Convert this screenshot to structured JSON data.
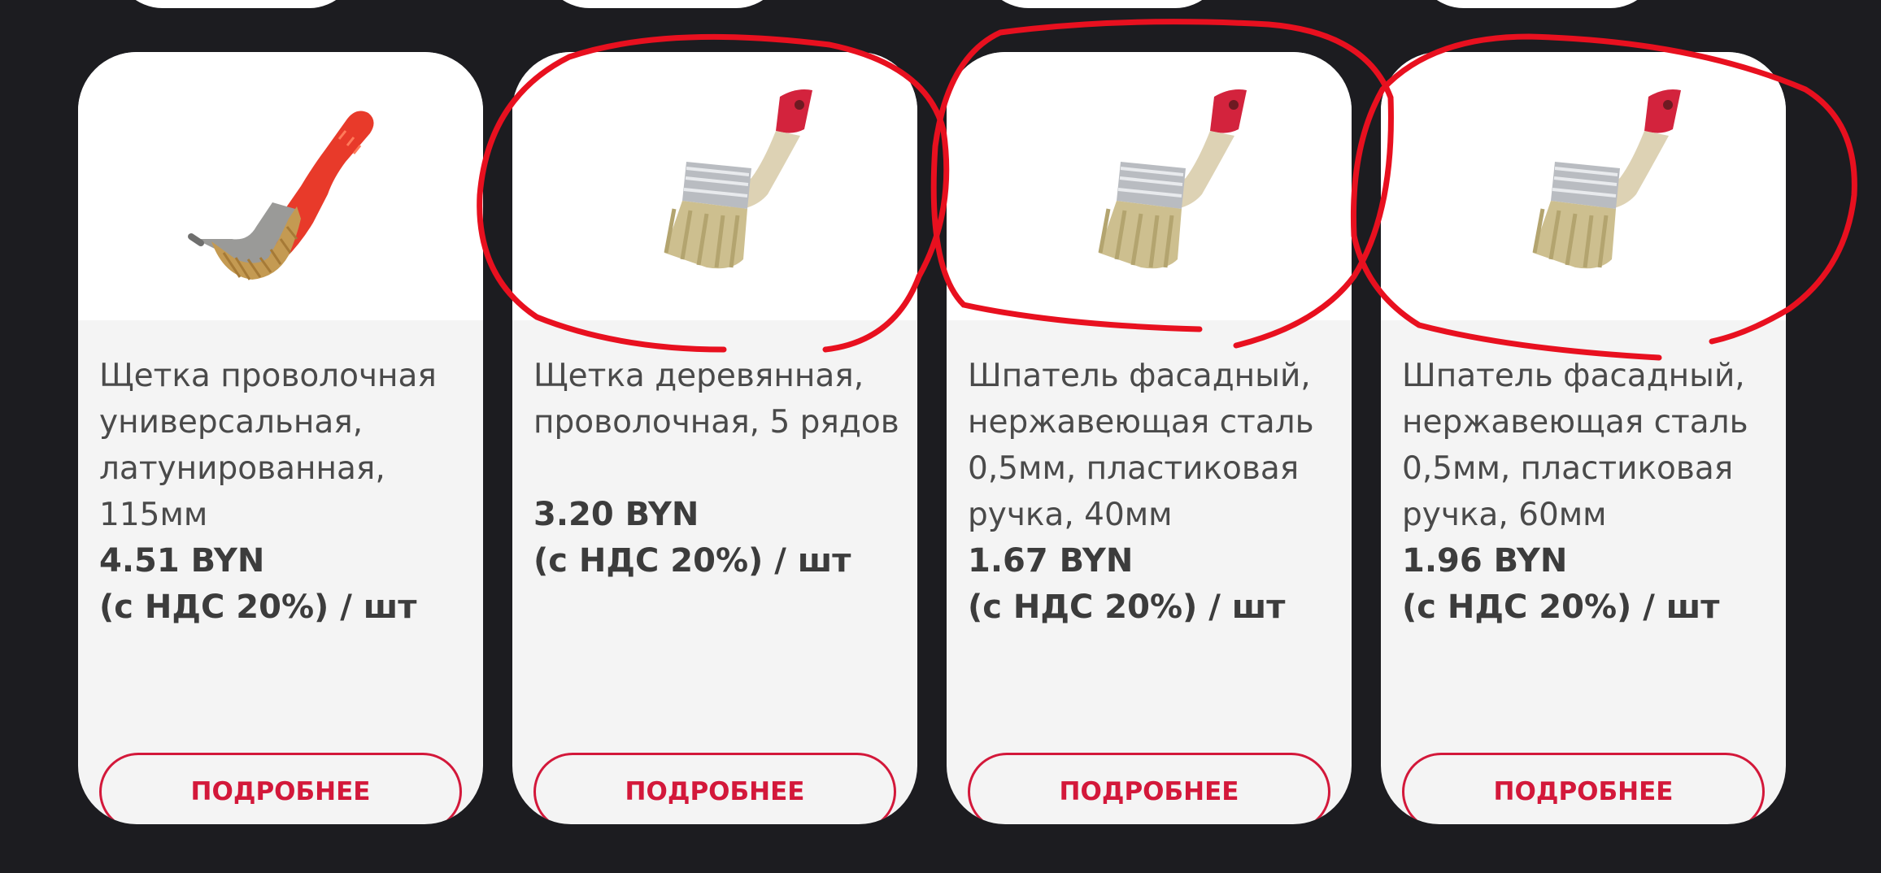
{
  "products": [
    {
      "title": "Щетка проволочная универсальная, латунированная, 115мм",
      "price": "4.51 BYN",
      "tax_unit": "(с НДС 20%) / шт",
      "button_label": "ПОДРОБНЕЕ",
      "image_icon": "wire-brush-icon"
    },
    {
      "title": "Щетка деревянная, проволочная, 5 рядов",
      "price": "3.20 BYN",
      "tax_unit": "(с НДС 20%) / шт",
      "button_label": "ПОДРОБНЕЕ",
      "image_icon": "paint-brush-icon"
    },
    {
      "title": "Шпатель фасадный, нержавеющая сталь 0,5мм, пластиковая ручка, 40мм",
      "price": "1.67 BYN",
      "tax_unit": "(с НДС 20%) / шт",
      "button_label": "ПОДРОБНЕЕ",
      "image_icon": "paint-brush-icon"
    },
    {
      "title": "Шпатель фасадный, нержавеющая сталь 0,5мм, пластиковая ручка, 60мм",
      "price": "1.96 BYN",
      "tax_unit": "(с НДС 20%) / шт",
      "button_label": "ПОДРОБНЕЕ",
      "image_icon": "paint-brush-icon"
    }
  ],
  "colors": {
    "background": "#1c1c20",
    "card": "#f4f4f4",
    "accent": "#d3183a",
    "annotation": "#e8101f"
  }
}
